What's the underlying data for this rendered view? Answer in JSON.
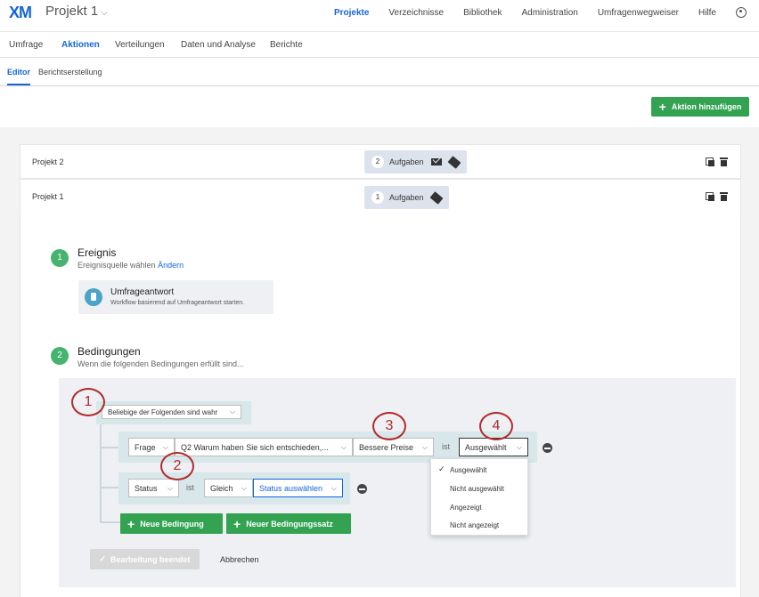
{
  "app": {
    "logo": "XM",
    "project": "Projekt 1"
  },
  "topnav": [
    "Projekte",
    "Verzeichnisse",
    "Bibliothek",
    "Administration",
    "Umfragenwegweiser",
    "Hilfe"
  ],
  "tabs": [
    "Umfrage",
    "Aktionen",
    "Verteilungen",
    "Daten und Analyse",
    "Berichte"
  ],
  "subtabs": [
    "Editor",
    "Berichtserstellung"
  ],
  "add_action_label": "Aktion hinzufügen",
  "actions": [
    {
      "name": "Projekt 2",
      "count": "2",
      "tasks_label": "Aufgaben"
    },
    {
      "name": "Projekt 1",
      "count": "1",
      "tasks_label": "Aufgaben"
    }
  ],
  "step1": {
    "number": "1",
    "title": "Ereignis",
    "subtitle": "Ereignisquelle wählen",
    "link": "Ändern"
  },
  "source": {
    "title": "Umfrageantwort",
    "desc": "Workflow basierend auf Umfrageantwort starten."
  },
  "step2": {
    "number": "2",
    "title": "Bedingungen",
    "subtitle": "Wenn die folgenden Bedingungen erfüllt sind..."
  },
  "conditions": {
    "group_select": "Beliebige der Folgenden sind wahr",
    "row1": {
      "type": "Frage",
      "question": "Q2 Warum haben Sie sich entschieden,...",
      "choice": "Bessere Preise",
      "is_label": "ist",
      "state": "Ausgewählt"
    },
    "row2": {
      "type": "Status",
      "is_label": "ist",
      "op": "Gleich",
      "value": "Status auswählen"
    },
    "add_condition": "Neue Bedingung",
    "add_set": "Neuer Bedingungssatz",
    "done": "Bearbeitung beendet",
    "cancel": "Abbrechen"
  },
  "dropdown": {
    "options": [
      "Ausgewählt",
      "Nicht ausgewählt",
      "Angezeigt",
      "Nicht angezeigt"
    ],
    "check": "✓"
  },
  "annotations": [
    "1",
    "2",
    "3",
    "4"
  ],
  "colors": {
    "accent": "#1566d6",
    "green": "#33a352",
    "annotation": "#b22b2b"
  }
}
